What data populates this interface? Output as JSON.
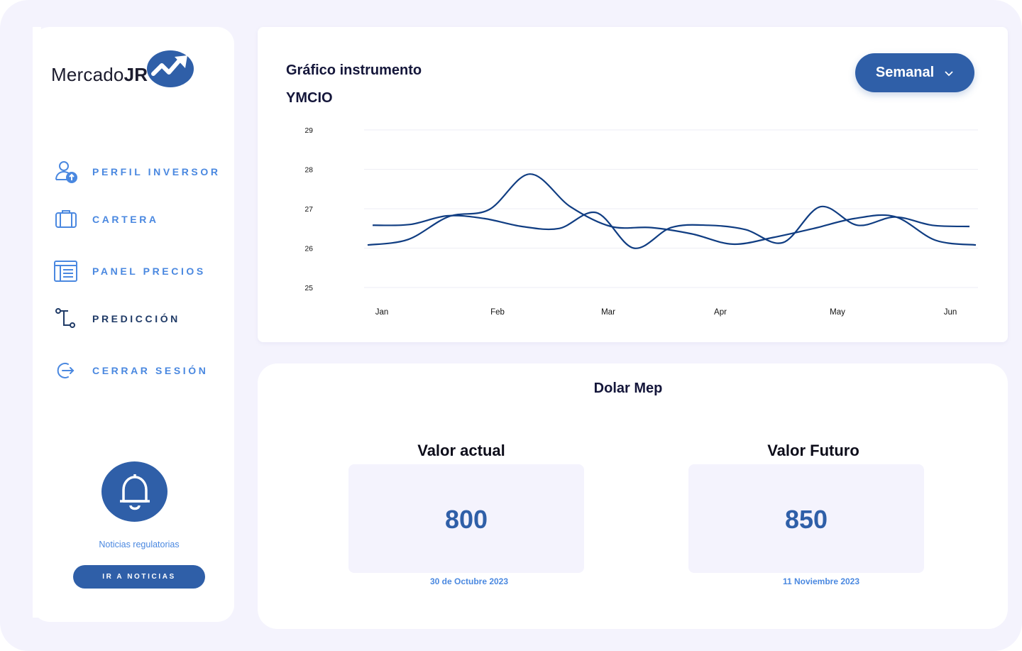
{
  "brand": {
    "name_light": "Mercado",
    "name_bold": "JR"
  },
  "sidebar": {
    "items": [
      {
        "label": "PERFIL INVERSOR",
        "icon": "user-upload-icon"
      },
      {
        "label": "CARTERA",
        "icon": "briefcase-icon"
      },
      {
        "label": "PANEL PRECIOS",
        "icon": "list-panel-icon"
      },
      {
        "label": "PREDICCIÓN",
        "icon": "prediction-path-icon",
        "active": true
      },
      {
        "label": "CERRAR SESIÓN",
        "icon": "logout-icon"
      }
    ],
    "news_label": "Noticias regulatorias",
    "news_button": "IR A NOTICIAS"
  },
  "chart_card": {
    "title": "Gráfico instrumento",
    "instrument": "YMCIO",
    "period": "Semanal"
  },
  "chart_data": {
    "type": "line",
    "categories": [
      "Jan",
      "Feb",
      "Mar",
      "Apr",
      "May",
      "Jun"
    ],
    "y_ticks": [
      25,
      26,
      27,
      28,
      29
    ],
    "ylim": [
      25,
      29
    ],
    "grid": true,
    "series": [
      {
        "values": [
          26.08,
          26.22,
          26.8,
          26.98,
          27.88,
          27.05,
          26.55,
          26.52,
          26.36,
          26.1,
          26.27,
          26.5,
          26.75,
          26.8,
          26.2,
          26.08
        ]
      },
      {
        "values": [
          26.58,
          26.6,
          26.82,
          26.75,
          26.55,
          26.5,
          26.9,
          26.0,
          26.52,
          26.58,
          26.47,
          26.14,
          27.05,
          26.58,
          26.79,
          26.58,
          26.55
        ]
      }
    ]
  },
  "colors": {
    "accent": "#2f5fa8",
    "line": "#103d82",
    "nav": "#4a88e0"
  },
  "dolar": {
    "title": "Dolar Mep",
    "current": {
      "label": "Valor actual",
      "value": "800",
      "date": "30 de Octubre 2023"
    },
    "future": {
      "label": "Valor Futuro",
      "value": "850",
      "date": "11 Noviembre 2023"
    }
  }
}
